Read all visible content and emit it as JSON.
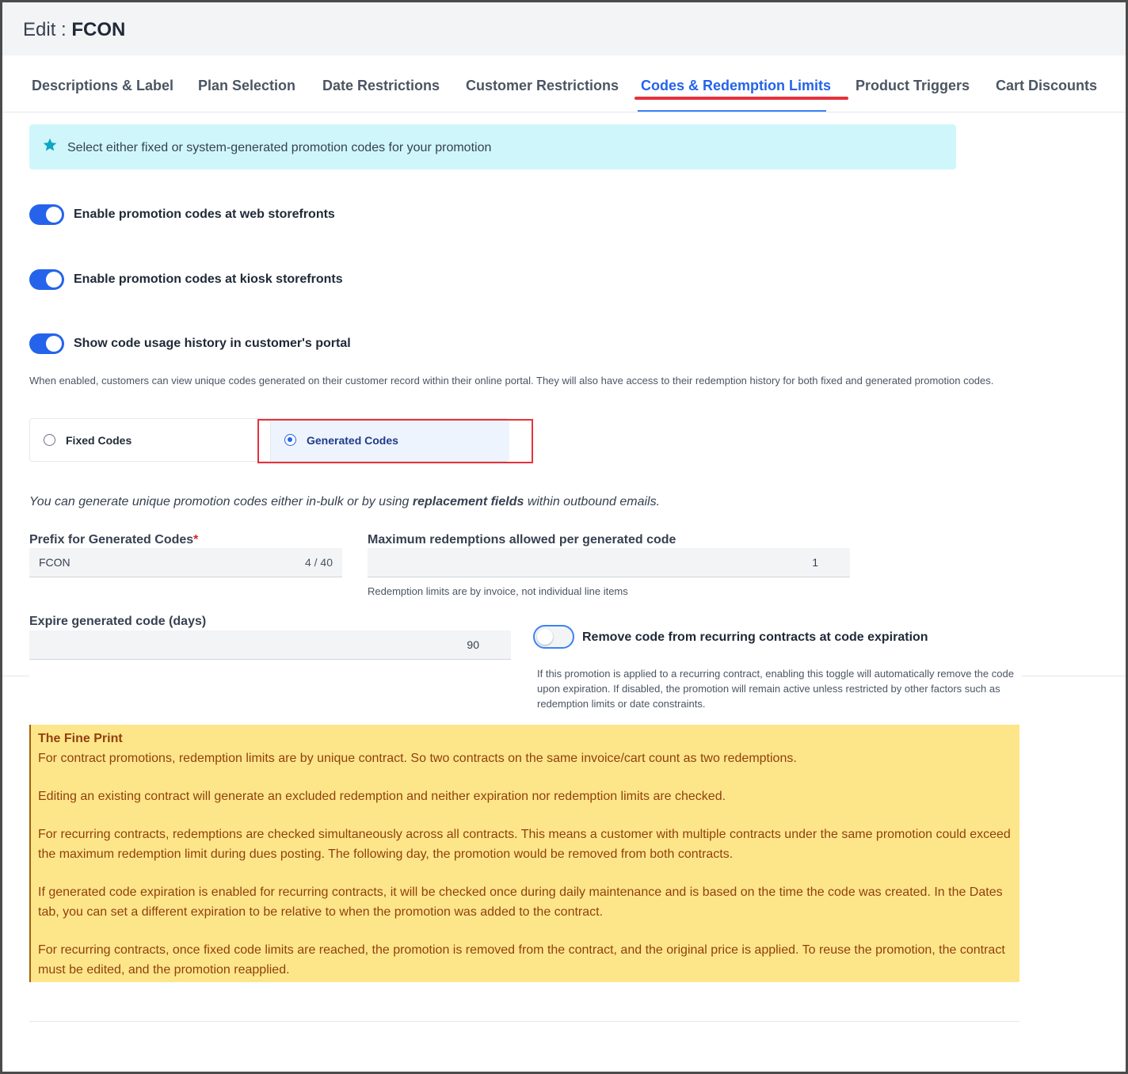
{
  "header": {
    "prefix": "Edit : ",
    "entity": "FCON"
  },
  "tabs": [
    {
      "label": "Descriptions & Label"
    },
    {
      "label": "Plan Selection"
    },
    {
      "label": "Date Restrictions"
    },
    {
      "label": "Customer Restrictions"
    },
    {
      "label": "Codes & Redemption Limits",
      "active": true
    },
    {
      "label": "Product Triggers"
    },
    {
      "label": "Cart Discounts"
    }
  ],
  "info_banner": {
    "icon": "star-icon",
    "text": "Select either fixed or system-generated promotion codes for your promotion"
  },
  "toggles": {
    "web": {
      "label": "Enable promotion codes at web storefronts",
      "on": true
    },
    "kiosk": {
      "label": "Enable promotion codes at kiosk storefronts",
      "on": true
    },
    "history": {
      "label": "Show code usage history in customer's portal",
      "on": true
    }
  },
  "history_help": "When enabled, customers can view unique codes generated on their customer record within their online portal. They will also have access to their redemption history for both fixed and generated promotion codes.",
  "code_type": {
    "options": [
      {
        "label": "Fixed Codes",
        "selected": false
      },
      {
        "label": "Generated Codes",
        "selected": true
      }
    ]
  },
  "intro": {
    "before": "You can generate unique promotion codes either in-bulk or by using ",
    "bold": "replacement fields",
    "after": " within outbound emails."
  },
  "fields": {
    "prefix": {
      "label": "Prefix for Generated Codes",
      "required_mark": "*",
      "value": "FCON",
      "counter": "4 / 40"
    },
    "max_redemptions": {
      "label": "Maximum redemptions allowed per generated code",
      "value": "1",
      "help": "Redemption limits are by invoice, not individual line items"
    },
    "expire": {
      "label": "Expire generated code (days)",
      "value": "90"
    }
  },
  "remove_toggle": {
    "label": "Remove code from recurring contracts at code expiration",
    "on": false,
    "help": "If this promotion is applied to a recurring contract, enabling this toggle will automatically remove the code upon expiration. If disabled, the promotion will remain active unless restricted by other factors such as redemption limits or date constraints."
  },
  "fine_print": {
    "title": "The Fine Print",
    "paragraphs": [
      "For contract promotions, redemption limits are by unique contract. So two contracts on the same invoice/cart count as two redemptions.",
      "Editing an existing contract will generate an excluded redemption and neither expiration nor redemption limits are checked.",
      "For recurring contracts, redemptions are checked simultaneously across all contracts. This means a customer with multiple contracts under the same promotion could exceed the maximum redemption limit during dues posting. The following day, the promotion would be removed from both contracts.",
      "If generated code expiration is enabled for recurring contracts, it will be checked once during daily maintenance and is based on the time the code was created. In the Dates tab, you can set a different expiration to be relative to when the promotion was added to the contract.",
      "For recurring contracts, once fixed code limits are reached, the promotion is removed from the contract, and the original price is applied. To reuse the promotion, the contract must be edited, and the promotion reapplied."
    ]
  },
  "colors": {
    "accent": "#2563eb",
    "annotation": "#e5323d",
    "banner": "#cff7fb",
    "fine_print_bg": "#fde68a"
  }
}
